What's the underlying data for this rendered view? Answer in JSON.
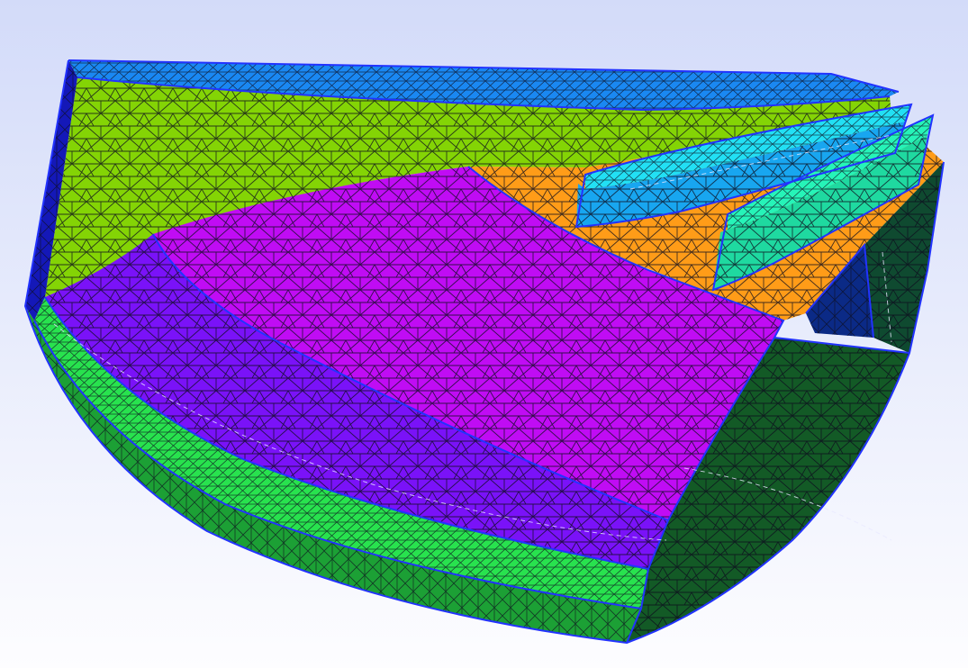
{
  "viewport": {
    "background_top": "#d3dbf9",
    "background_bottom": "#fdfdff",
    "mesh_line_color": "#0d0d1e",
    "edge_color": "#2233ff",
    "surfaces": [
      {
        "name": "top-rim-surface",
        "color": "#1a88f2"
      },
      {
        "name": "inner-wall-surface",
        "color": "#84d405"
      },
      {
        "name": "left-end-surface",
        "color": "#1418b8"
      },
      {
        "name": "magenta-top-surface",
        "color": "#c00cf4"
      },
      {
        "name": "violet-band-surface",
        "color": "#7a12f8"
      },
      {
        "name": "green-band-surface",
        "color": "#28e24e"
      },
      {
        "name": "dark-green-band-surface",
        "color": "#1ca035"
      },
      {
        "name": "orange-surface",
        "color": "#ff9c18"
      },
      {
        "name": "cyan-blade-surface",
        "color": "#22e0f4"
      },
      {
        "name": "cyan-blade-front-surface",
        "color": "#18a6f0"
      },
      {
        "name": "teal-blade-surface",
        "color": "#26f4b8"
      },
      {
        "name": "teal-blade-front-surface",
        "color": "#1fd9a0"
      },
      {
        "name": "dark-right-wall-surface",
        "color": "#135a26"
      },
      {
        "name": "right-recess-surface",
        "color": "#0b2a86"
      },
      {
        "name": "right-inner-wall-surface",
        "color": "#0f4a30"
      }
    ]
  }
}
